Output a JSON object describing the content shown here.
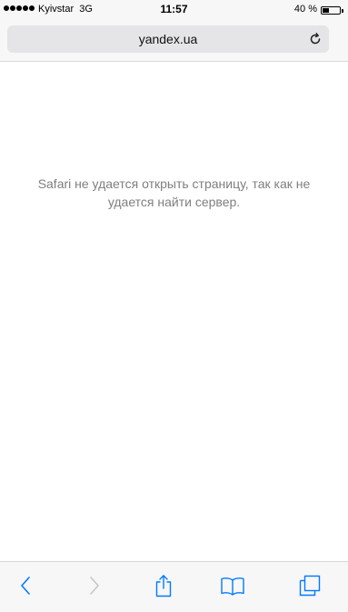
{
  "status_bar": {
    "carrier": "Kyivstar",
    "network": "3G",
    "time": "11:57",
    "battery_percent_text": "40 %",
    "battery_level": 0.4,
    "signal_bars": 5
  },
  "address_bar": {
    "url": "yandex.ua",
    "reload_icon": "reload-icon"
  },
  "page": {
    "error_message": "Safari не удается открыть страницу, так как не удается найти сервер."
  },
  "toolbar": {
    "back_icon": "chevron-left-icon",
    "forward_icon": "chevron-right-icon",
    "share_icon": "share-icon",
    "bookmarks_icon": "book-icon",
    "tabs_icon": "tabs-icon",
    "accent_color": "#007aff",
    "disabled_color": "#c7c7cc"
  }
}
